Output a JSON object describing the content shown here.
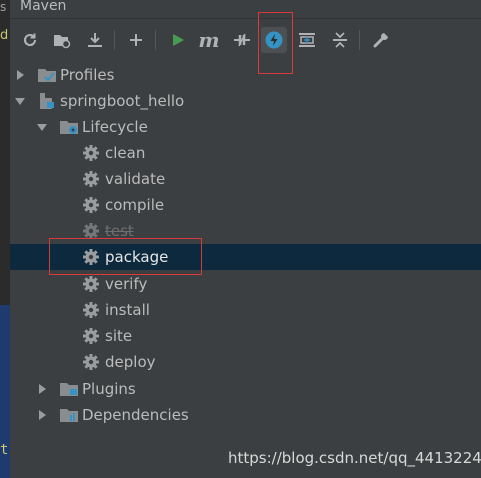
{
  "window": {
    "title": "Maven"
  },
  "gutter": {
    "top_char": "s",
    "char": "d",
    "bottom_char": "t"
  },
  "toolbar": {
    "buttons": [
      {
        "name": "reload-icon"
      },
      {
        "name": "generate-sources-icon"
      },
      {
        "name": "download-icon"
      },
      {
        "name": "add-icon"
      },
      {
        "name": "run-icon"
      },
      {
        "name": "execute-goal-icon",
        "label": "m"
      },
      {
        "name": "toggle-offline-icon"
      },
      {
        "name": "skip-tests-icon",
        "selected": true
      },
      {
        "name": "show-dependencies-icon"
      },
      {
        "name": "collapse-all-icon"
      },
      {
        "name": "settings-wrench-icon"
      }
    ]
  },
  "tree": {
    "items": [
      {
        "label": "Profiles",
        "icon": "profiles-icon",
        "expanded": false
      },
      {
        "label": "springboot_hello",
        "icon": "maven-project-icon",
        "expanded": true
      },
      {
        "label": "Lifecycle",
        "icon": "lifecycle-folder-icon",
        "expanded": true
      },
      {
        "label": "clean",
        "icon": "gear-icon"
      },
      {
        "label": "validate",
        "icon": "gear-icon"
      },
      {
        "label": "compile",
        "icon": "gear-icon"
      },
      {
        "label": "test",
        "icon": "gear-icon",
        "skipped": true
      },
      {
        "label": "package",
        "icon": "gear-icon",
        "selected": true
      },
      {
        "label": "verify",
        "icon": "gear-icon"
      },
      {
        "label": "install",
        "icon": "gear-icon"
      },
      {
        "label": "site",
        "icon": "gear-icon"
      },
      {
        "label": "deploy",
        "icon": "gear-icon"
      },
      {
        "label": "Plugins",
        "icon": "plugins-folder-icon",
        "expanded": false
      },
      {
        "label": "Dependencies",
        "icon": "dependencies-folder-icon",
        "expanded": false
      }
    ]
  },
  "watermark": "https://blog.csdn.net/qq_44132240",
  "colors": {
    "background": "#3c3f41",
    "selection": "#0d293e",
    "highlight_box": "#d63a3a",
    "run_green": "#499c54",
    "skip_tests_blue": "#3592c4"
  }
}
